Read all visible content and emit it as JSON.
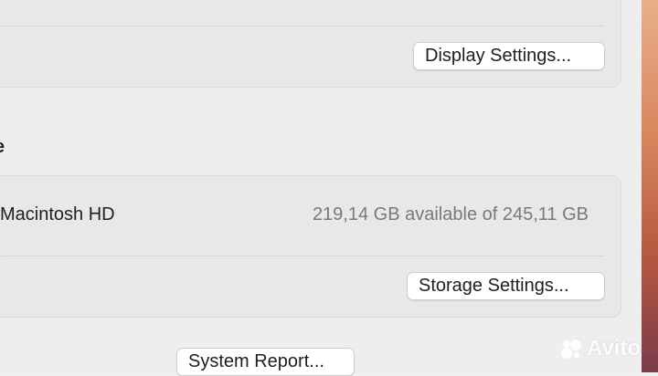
{
  "display": {
    "settings_button": "Display Settings..."
  },
  "storage": {
    "section_heading": "e",
    "disk_name": "Macintosh HD",
    "disk_capacity": "219,14 GB available of 245,11 GB",
    "settings_button": "Storage Settings..."
  },
  "footer": {
    "system_report_button": "System Report..."
  },
  "watermark": {
    "text": "Avito",
    "icon": "avito-logo-icon"
  },
  "colors": {
    "window_background": "#efeeef",
    "group_background": "#e9e8e9",
    "secondary_text": "#7a797a"
  }
}
